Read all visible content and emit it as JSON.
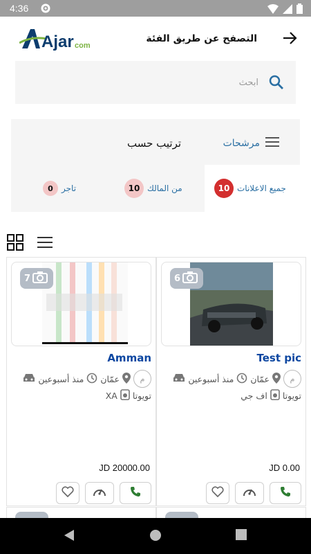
{
  "status_bar": {
    "time": "4:36"
  },
  "header": {
    "logo_text": "Ajar",
    "logo_suffix": "com",
    "title": "التصفح عن طريق الفئة"
  },
  "search": {
    "placeholder": "ابحث"
  },
  "toolbar": {
    "sort_label": "ترتيب حسب",
    "filter_label": "مرشحات"
  },
  "tabs": [
    {
      "label": "جميع الاعلانات",
      "count": "10",
      "active": true
    },
    {
      "label": "من المالك",
      "count": "10",
      "active": false
    },
    {
      "label": "تاجر",
      "count": "0",
      "active": false
    }
  ],
  "listings": [
    {
      "title": "Test pic",
      "photo_count": "6",
      "owner_initial": "م",
      "location": "عمّان",
      "time_ago": "منذ أسبوعين",
      "make": "تويوتا",
      "model": "اف جي",
      "price": "JD 0.00"
    },
    {
      "title": "Amman",
      "photo_count": "7",
      "owner_initial": "م",
      "location": "عمّان",
      "time_ago": "منذ أسبوعين",
      "make": "تويوتا",
      "model": "XA",
      "price": "JD 20000.00"
    }
  ],
  "colors": {
    "accent_blue": "#2a6fa3",
    "title_blue": "#0d47a1",
    "badge_red": "#d32f2f",
    "badge_pink": "#f3c6c6",
    "call_green": "#2e7d32"
  }
}
